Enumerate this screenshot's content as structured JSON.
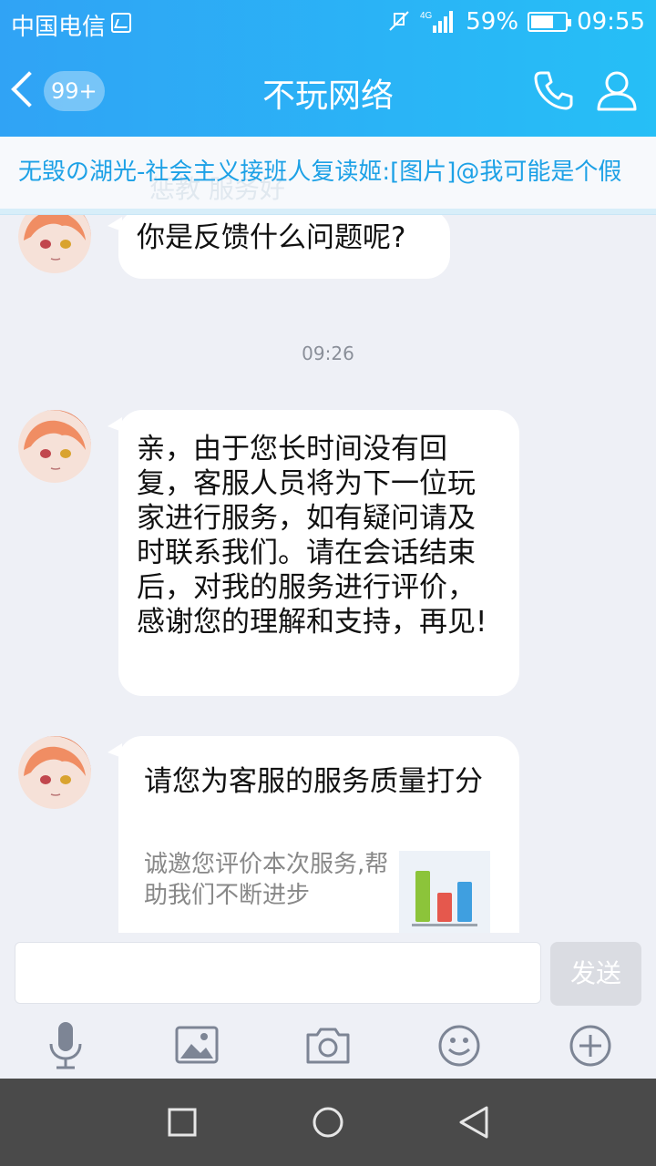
{
  "status_bar": {
    "carrier": "中国电信",
    "battery": "59%",
    "time": "09:55"
  },
  "header": {
    "unread_count": "99+",
    "title": "不玩网络"
  },
  "notice": {
    "text": "无毁の湖光-社会主义接班人复读姬:[图片]@我可能是个假",
    "underlay": "惩教   服务好"
  },
  "messages": [
    {
      "text": "你是反馈什么问题呢?"
    },
    {
      "text": "亲，由于您长时间没有回复，客服人员将为下一位玩家进行服务，如有疑问请及时联系我们。请在会话结束后，对我的服务进行评价，感谢您的理解和支持，再见!"
    }
  ],
  "time_divider": "09:26",
  "rating_card": {
    "title": "请您为客服的服务质量打分",
    "description": "诚邀您评价本次服务,帮助我们不断进步"
  },
  "composer": {
    "input_value": "",
    "send_label": "发送"
  },
  "colors": {
    "header_start": "#30a3f5",
    "header_end": "#26bff6",
    "notice_text": "#1da1e6",
    "chat_bg": "#eef0f6",
    "navbar": "#4a4a4a"
  },
  "icons": [
    "back-chevron-icon",
    "phone-icon",
    "profile-icon",
    "microphone-icon",
    "image-icon",
    "camera-icon",
    "emoji-icon",
    "plus-icon",
    "recent-apps-icon",
    "home-icon",
    "back-nav-icon"
  ]
}
